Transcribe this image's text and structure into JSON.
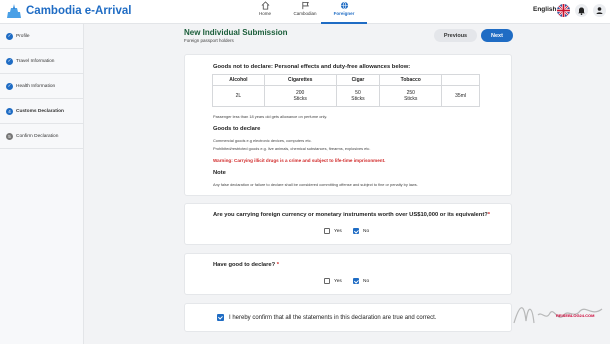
{
  "app": {
    "name": "Cambodia e-Arrival"
  },
  "nav": [
    {
      "label": "Home",
      "icon": "home-icon"
    },
    {
      "label": "Cambodian",
      "icon": "flag-icon"
    },
    {
      "label": "Foreigner",
      "icon": "globe-icon",
      "active": true
    }
  ],
  "header": {
    "language": "English"
  },
  "sidebar": {
    "items": [
      {
        "label": "Profile",
        "marker": "done"
      },
      {
        "label": "Travel Information",
        "marker": "done"
      },
      {
        "label": "Health Information",
        "marker": "done"
      },
      {
        "label": "Customs Declaration",
        "marker": "4"
      },
      {
        "label": "Confirm Declaration",
        "marker": "5"
      }
    ]
  },
  "page": {
    "title": "New Individual Submission",
    "subtitle": "Foreign passport holders",
    "previous_label": "Previous",
    "next_label": "Next"
  },
  "allowances": {
    "title": "Goods not to declare: Personal effects and duty-free allowances below:",
    "headers": [
      "Alcohol",
      "Cigarettes",
      "Cigar",
      "Tobacco",
      ""
    ],
    "row": [
      [
        "2L"
      ],
      [
        "200",
        "Sticks"
      ],
      [
        "50",
        "Sticks"
      ],
      [
        "250",
        "Sticks"
      ],
      [
        "35ml"
      ]
    ],
    "note_age": "Passenger less than 18 years old gets allowance on perfume only.",
    "declare_heading": "Goods to declare",
    "declare_line1": "Commercial goods e.g electronic devices, computers etc.",
    "declare_line2": "Prohibited/restricted goods e.g. live animals, chemical substances, firearms, explosives etc.",
    "warning": "Warning: Carrying illicit drugs is a crime and subject to life-time imprisonment.",
    "note_heading": "Note",
    "note_text": "Any false declaration or failure to declare shall be considered committing offense and subject to fine or penalty by laws."
  },
  "q_currency": {
    "question": "Are you carrying foreign currency or monetary instruments worth over US$10,000 or its equivalent?",
    "required_mark": "*",
    "yes_label": "Yes",
    "no_label": "No",
    "selected": "No"
  },
  "q_goods": {
    "question": "Have good to declare?",
    "required_mark": "*",
    "yes_label": "Yes",
    "no_label": "No",
    "selected": "No"
  },
  "confirm": {
    "label": "I hereby confirm that all the statements in this declaration are true and correct.",
    "checked": true
  },
  "watermark": {
    "site": "REISEBLOG24.COM"
  },
  "colors": {
    "primary": "#1f6cc4",
    "title_green": "#1b5e3a",
    "warning_red": "#d12a2a"
  }
}
